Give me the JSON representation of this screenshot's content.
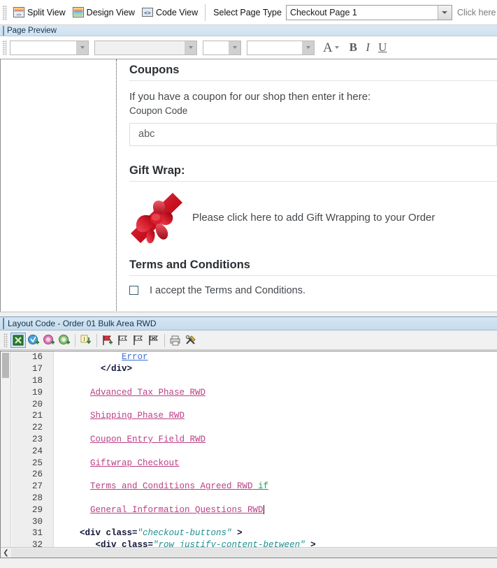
{
  "top_toolbar": {
    "buttons": [
      {
        "label": "Split View",
        "icon": "split-view-icon"
      },
      {
        "label": "Design View",
        "icon": "design-view-icon"
      },
      {
        "label": "Code View",
        "icon": "code-view-icon"
      }
    ],
    "page_type_label": "Select Page Type",
    "page_type_value": "Checkout Page 1",
    "hint": "Click here to see e"
  },
  "page_preview": {
    "title": "Page Preview"
  },
  "format_toolbar": {
    "font_family": "",
    "style": "",
    "size": "",
    "extra": "",
    "font_color_icon": "font-color-icon",
    "bold": "B",
    "italic": "I",
    "underline": "U"
  },
  "preview": {
    "coupons": {
      "heading": "Coupons",
      "intro": "If you have a coupon for our shop then enter it here:",
      "field_label": "Coupon Code",
      "field_value": "abc"
    },
    "giftwrap": {
      "heading": "Gift Wrap:",
      "icon": "gift-bow-icon",
      "text": "Please click here to add Gift Wrapping to your Order"
    },
    "terms": {
      "heading": "Terms and Conditions",
      "checkbox_label": "I accept the Terms and Conditions.",
      "checked": false
    }
  },
  "layout_code": {
    "title": "Layout Code  - Order 01 Bulk Area RWD",
    "toolbar_icons": [
      "close-all-icon",
      "add-blue-tag-icon",
      "add-pink-tag-icon",
      "add-green-tag-icon",
      "insert-text-icon",
      "add-bookmark-icon",
      "next-bookmark-icon",
      "prev-bookmark-icon",
      "clear-bookmark-icon",
      "print-icon",
      "tools-icon"
    ],
    "lines": [
      {
        "num": "16",
        "segments": [
          {
            "text": "            ",
            "type": "plain"
          },
          {
            "text": "Error",
            "type": "link-blue"
          }
        ]
      },
      {
        "num": "17",
        "segments": [
          {
            "text": "        ",
            "type": "plain"
          },
          {
            "text": "</div>",
            "type": "tag"
          }
        ]
      },
      {
        "num": "18",
        "segments": []
      },
      {
        "num": "19",
        "segments": [
          {
            "text": "      ",
            "type": "plain"
          },
          {
            "text": "Advanced Tax Phase RWD",
            "type": "link"
          }
        ]
      },
      {
        "num": "20",
        "segments": []
      },
      {
        "num": "21",
        "segments": [
          {
            "text": "      ",
            "type": "plain"
          },
          {
            "text": "Shipping Phase RWD",
            "type": "link"
          }
        ]
      },
      {
        "num": "22",
        "segments": []
      },
      {
        "num": "23",
        "segments": [
          {
            "text": "      ",
            "type": "plain"
          },
          {
            "text": "Coupon Entry Field RWD",
            "type": "link"
          }
        ]
      },
      {
        "num": "24",
        "segments": []
      },
      {
        "num": "25",
        "segments": [
          {
            "text": "      ",
            "type": "plain"
          },
          {
            "text": "Giftwrap Checkout",
            "type": "link"
          }
        ]
      },
      {
        "num": "26",
        "segments": []
      },
      {
        "num": "27",
        "segments": [
          {
            "text": "      ",
            "type": "plain"
          },
          {
            "text": "Terms and Conditions Agreed RWD",
            "type": "link"
          },
          {
            "text": " if",
            "type": "green"
          }
        ]
      },
      {
        "num": "28",
        "segments": []
      },
      {
        "num": "29",
        "segments": [
          {
            "text": "      ",
            "type": "plain"
          },
          {
            "text": "General Information Questions RWD",
            "type": "link"
          },
          {
            "text": "",
            "type": "caret"
          }
        ]
      },
      {
        "num": "30",
        "segments": []
      },
      {
        "num": "31",
        "segments": [
          {
            "text": "    ",
            "type": "plain"
          },
          {
            "text": "<div class=",
            "type": "tag"
          },
          {
            "text": "\"checkout-buttons\"",
            "type": "attr-val"
          },
          {
            "text": " >",
            "type": "tag"
          }
        ]
      },
      {
        "num": "32",
        "segments": [
          {
            "text": "       ",
            "type": "plain"
          },
          {
            "text": "<div class=",
            "type": "tag"
          },
          {
            "text": "\"row justify-content-between\"",
            "type": "attr-val"
          },
          {
            "text": " >",
            "type": "tag"
          }
        ]
      }
    ]
  },
  "colors": {
    "link_purple": "#bb3e84",
    "link_blue": "#3b6fd4",
    "attr_teal": "#1e8e8e",
    "keyword_green": "#1f9e53",
    "bow_red": "#c9162a",
    "title_blue": "#14324d"
  }
}
